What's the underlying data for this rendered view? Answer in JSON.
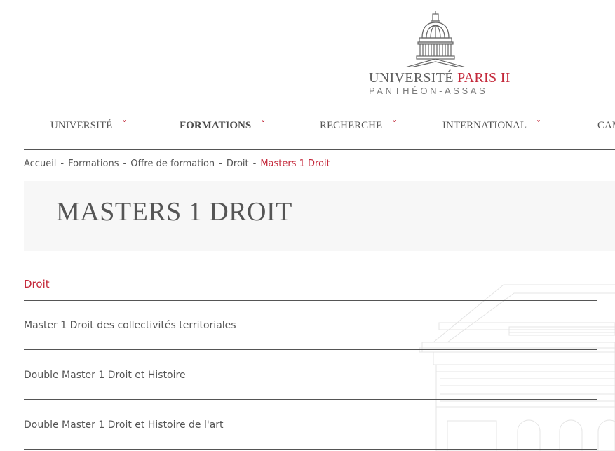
{
  "logo": {
    "line1_main": "UNIVERSITÉ ",
    "line1_accent": "PARIS II",
    "line2": "PANTHÉON-ASSAS",
    "icon": "pantheon-dome-icon"
  },
  "nav": {
    "items": [
      {
        "label": "UNIVERSITÉ",
        "active": false
      },
      {
        "label": "FORMATIONS",
        "active": true
      },
      {
        "label": "RECHERCHE",
        "active": false
      },
      {
        "label": "INTERNATIONAL",
        "active": false
      },
      {
        "label": "CAM",
        "active": false
      }
    ],
    "chevron": "˅"
  },
  "breadcrumb": {
    "items": [
      "Accueil",
      "Formations",
      "Offre de formation",
      "Droit"
    ],
    "current": "Masters 1 Droit",
    "separator": "-"
  },
  "page": {
    "title": "MASTERS 1 DROIT"
  },
  "section": {
    "heading": "Droit",
    "items": [
      "Master 1 Droit des collectivités territoriales",
      "Double Master 1 Droit et Histoire",
      "Double Master 1 Droit et Histoire de l'art"
    ]
  },
  "colors": {
    "accent": "#c4283a",
    "text": "#555555",
    "title_bg": "#f7f7f7"
  }
}
